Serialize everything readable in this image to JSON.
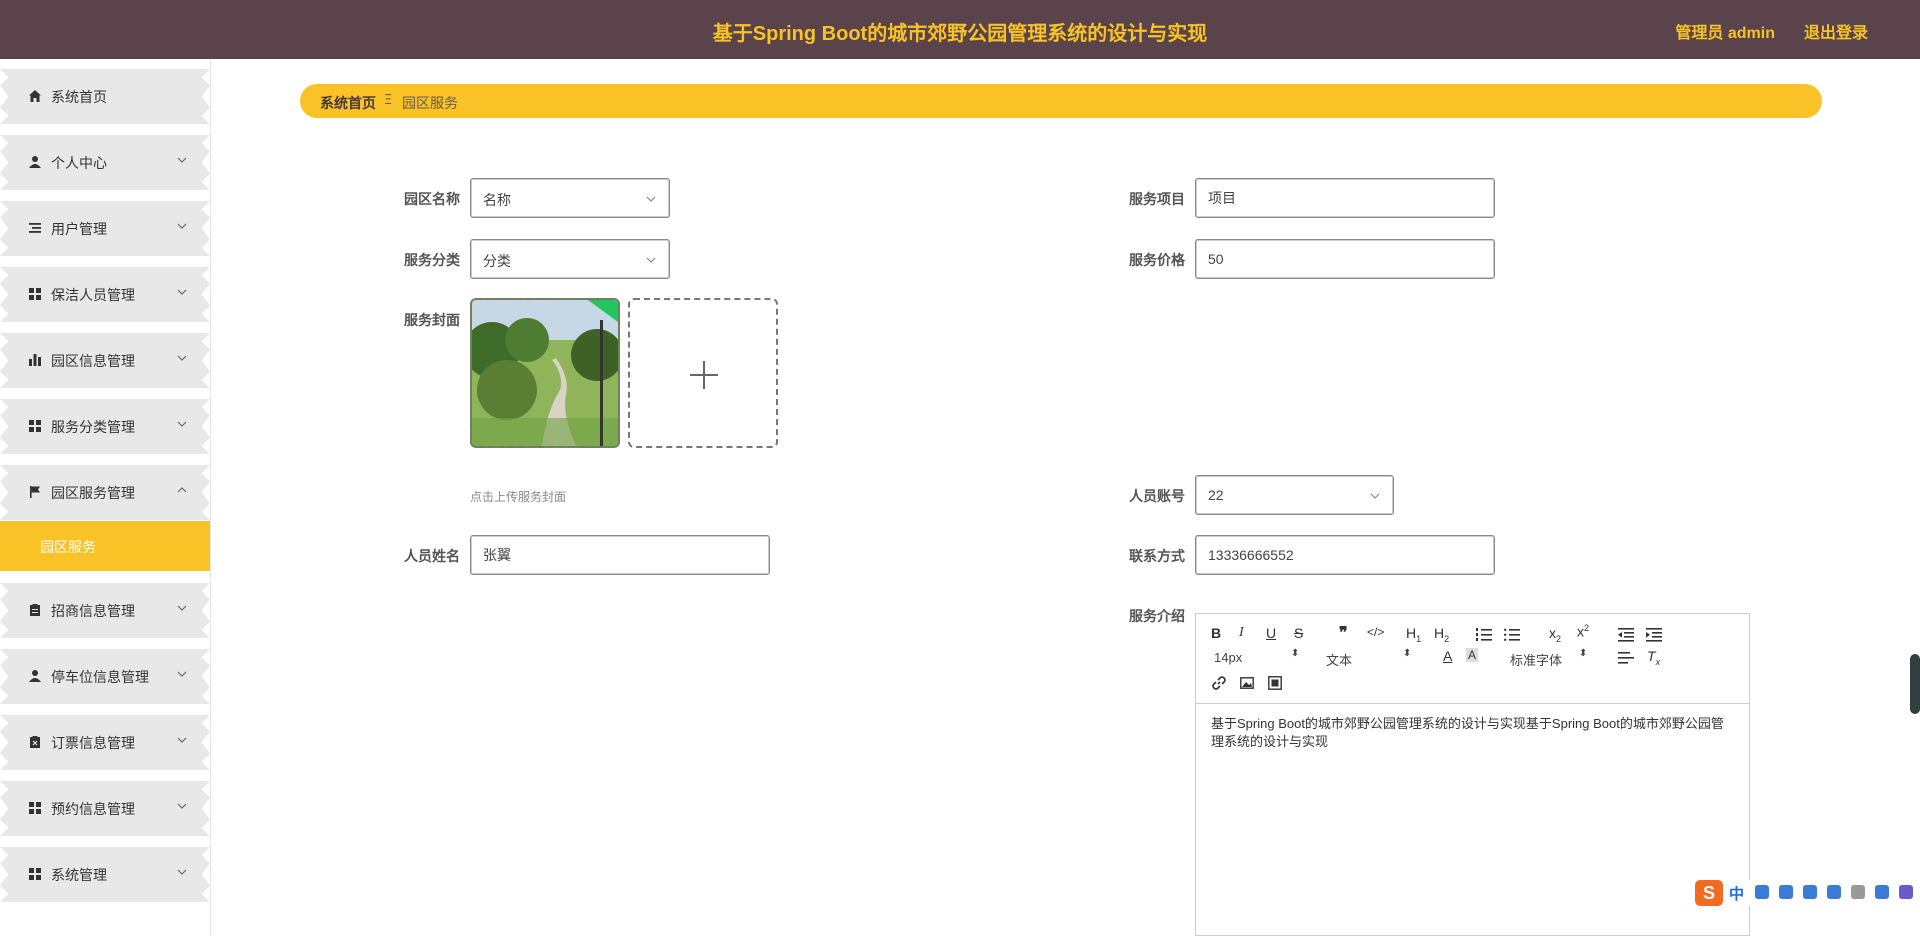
{
  "header": {
    "title": "基于Spring Boot的城市郊野公园管理系统的设计与实现",
    "user": "管理员 admin",
    "logout": "退出登录"
  },
  "sidebar": {
    "items": [
      {
        "label": "系统首页",
        "icon": "home-icon"
      },
      {
        "label": "个人中心",
        "icon": "person-icon"
      },
      {
        "label": "用户管理",
        "icon": "list-icon"
      },
      {
        "label": "保洁人员管理",
        "icon": "grid-icon"
      },
      {
        "label": "园区信息管理",
        "icon": "bar-chart-icon"
      },
      {
        "label": "服务分类管理",
        "icon": "grid-icon"
      },
      {
        "label": "园区服务管理",
        "icon": "flag-icon"
      },
      {
        "label": "招商信息管理",
        "icon": "clipboard-icon"
      },
      {
        "label": "停车位信息管理",
        "icon": "person-icon"
      },
      {
        "label": "订票信息管理",
        "icon": "clipboard-x-icon"
      },
      {
        "label": "预约信息管理",
        "icon": "grid-icon"
      },
      {
        "label": "系统管理",
        "icon": "grid-icon"
      }
    ],
    "active_sub": "园区服务"
  },
  "breadcrumb": {
    "home": "系统首页",
    "separator": "Ξ",
    "current": "园区服务"
  },
  "form": {
    "park_name_label": "园区名称",
    "park_name_value": "名称",
    "service_item_label": "服务项目",
    "service_item_value": "项目",
    "service_category_label": "服务分类",
    "service_category_value": "分类",
    "service_price_label": "服务价格",
    "service_price_value": "50",
    "cover_label": "服务封面",
    "cover_hint": "点击上传服务封面",
    "staff_account_label": "人员账号",
    "staff_account_value": "22",
    "staff_name_label": "人员姓名",
    "staff_name_value": "张翼",
    "contact_label": "联系方式",
    "contact_value": "13336666552",
    "intro_label": "服务介绍"
  },
  "editor": {
    "font_size": "14px",
    "block_type": "文本",
    "font_family": "标准字体",
    "content": "基于Spring Boot的城市郊野公园管理系统的设计与实现基于Spring Boot的城市郊野公园管理系统的设计与实现"
  },
  "ime": {
    "logo": "S",
    "lang": "中"
  },
  "colors": {
    "header_bg": "#5b434b",
    "accent": "#f9c227",
    "title_text": "#f7c325"
  }
}
